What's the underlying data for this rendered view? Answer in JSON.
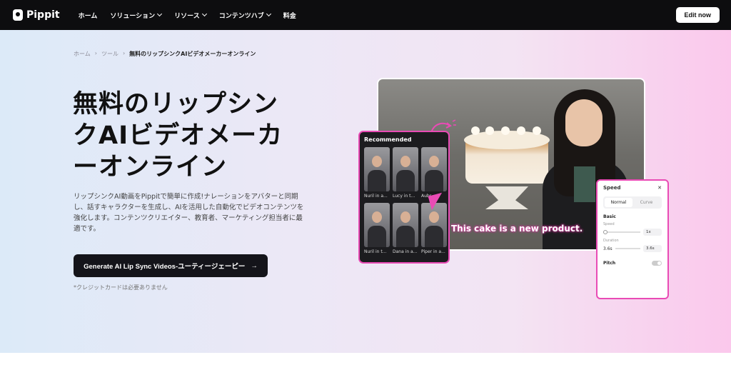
{
  "nav": {
    "brand": "Pippit",
    "items": [
      {
        "label": "ホーム",
        "dropdown": false
      },
      {
        "label": "ソリューション",
        "dropdown": true
      },
      {
        "label": "リソース",
        "dropdown": true
      },
      {
        "label": "コンテンツハブ",
        "dropdown": true
      },
      {
        "label": "料金",
        "dropdown": false
      }
    ],
    "cta": "Edit now"
  },
  "breadcrumb": {
    "home": "ホーム",
    "tools": "ツール",
    "sep": "›",
    "current": "無料のリップシンクAIビデオメーカーオンライン"
  },
  "hero": {
    "title": "無料のリップシンクAIビデオメーカーオンライン",
    "description": "リップシンクAI動画をPippitで簡単に作成!ナレーションをアバターと同期し、話すキャラクターを生成し、AIを活用した自動化でビデオコンテンツを強化します。コンテンツクリエイター、教育者、マーケティング担当者に最適です。",
    "cta": "Generate AI Lip Sync Videos-ユーティージェーピー",
    "note": "*クレジットカードは必要ありません"
  },
  "visual": {
    "caption": "This cake is a new product.",
    "recommended": {
      "title": "Recommended",
      "items": [
        "Nuril in a...",
        "Lucy in t...",
        "Aubr...",
        "Nuril in t...",
        "Dana in a...",
        "Piper in a..."
      ]
    },
    "speed_panel": {
      "title": "Speed",
      "tabs": [
        "Normal",
        "Curve"
      ],
      "section": "Basic",
      "speed_label": "Speed",
      "speed_value": "1x",
      "duration_label": "Duration",
      "duration_from": "3.6s",
      "duration_to": "3.6s",
      "pitch_label": "Pitch"
    }
  },
  "colors": {
    "accent": "#e94bb5",
    "nav_bg": "#0d0d0f"
  }
}
